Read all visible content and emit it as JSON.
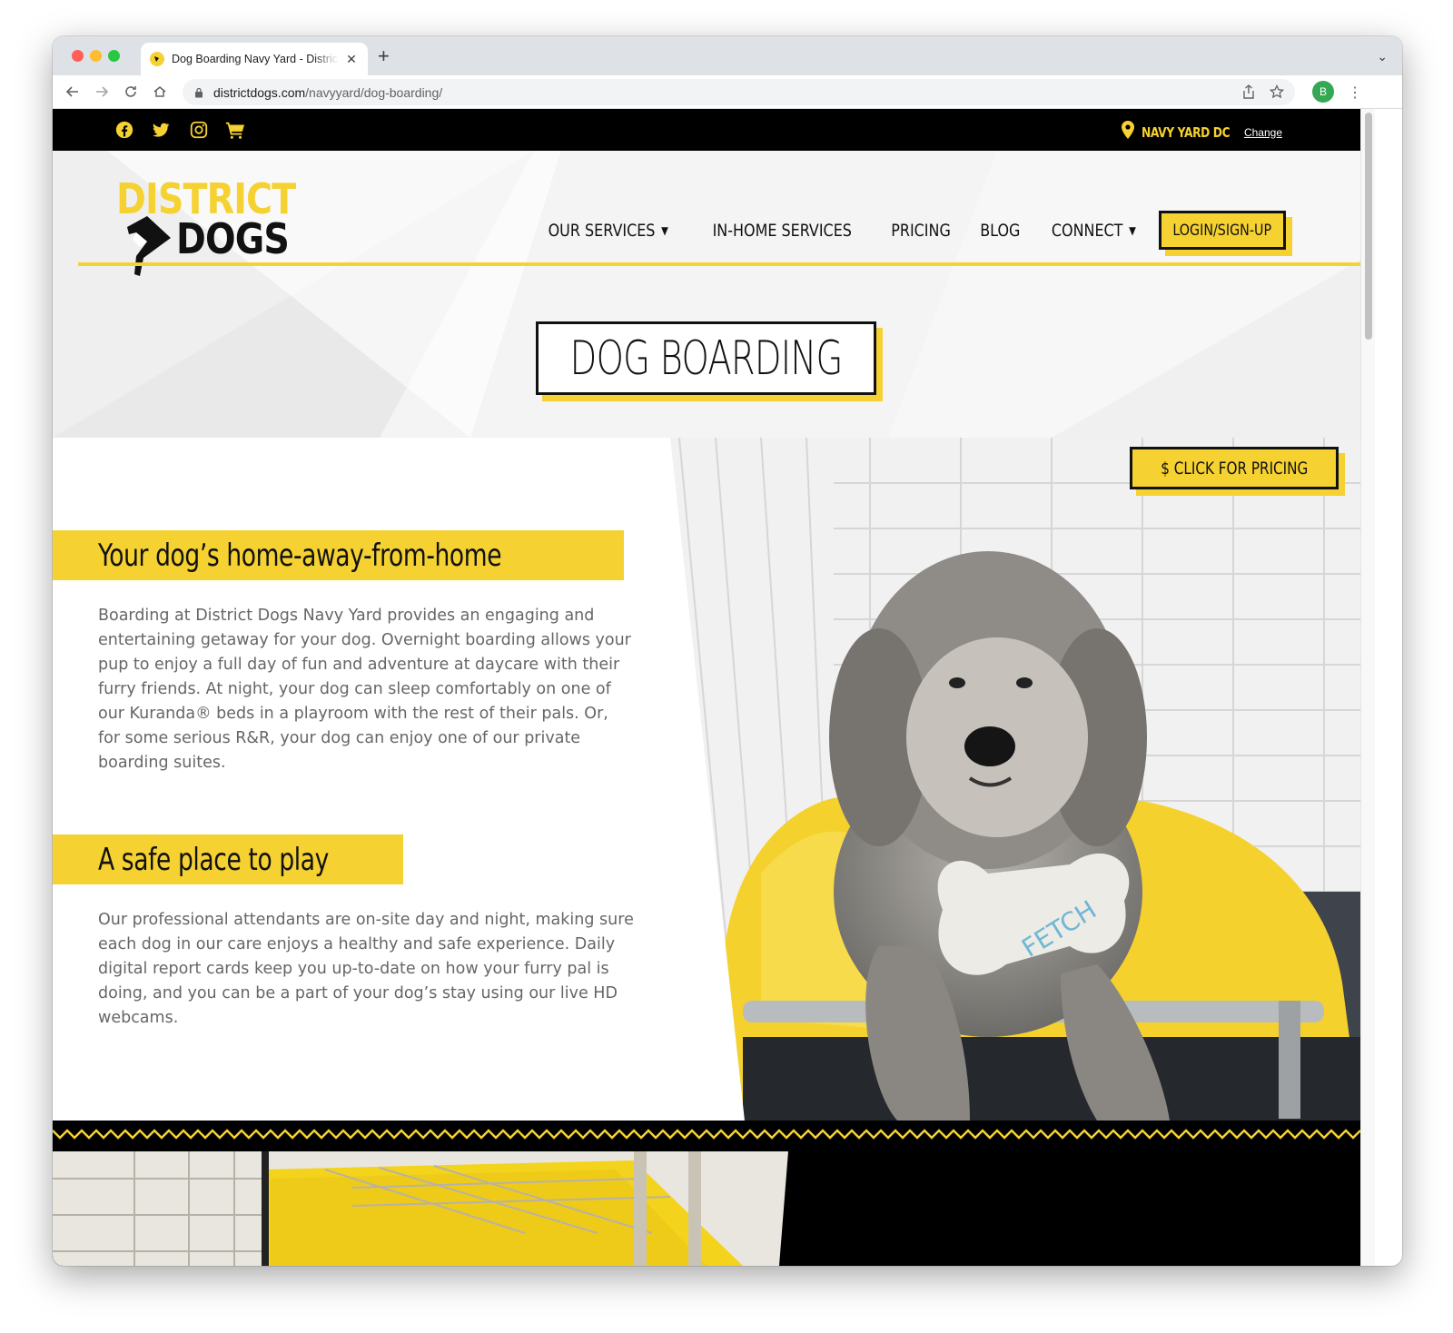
{
  "browser": {
    "tab_title": "Dog Boarding Navy Yard - District Dogs",
    "url_host": "districtdogs.com",
    "url_path": "/navyyard/dog-boarding/",
    "profile_initial": "B"
  },
  "topbar": {
    "social_icons": [
      "facebook-icon",
      "twitter-icon",
      "instagram-icon",
      "cart-icon"
    ],
    "location_label": "NAVY YARD DC",
    "change_label": "Change"
  },
  "logo": {
    "line1": "DISTRICT",
    "line2": "DOGS"
  },
  "nav": {
    "services": "OUR SERVICES",
    "in_home": "IN-HOME SERVICES",
    "pricing": "PRICING",
    "blog": "BLOG",
    "connect": "CONNECT",
    "login": "LOGIN/SIGN-UP"
  },
  "page_title": "DOG BOARDING",
  "pricing_button": "CLICK FOR PRICING",
  "sections": [
    {
      "heading": "Your dog’s home-away-from-home",
      "body": "Boarding at District Dogs Navy Yard provides an engaging and entertaining getaway for your dog. Overnight boarding allows your pup to enjoy a full day of fun and adventure at daycare with their furry friends. At night, your dog can sleep comfortably on one of our Kuranda® beds in a playroom with the rest of their pals. Or, for some serious R&R, your dog can enjoy one of our private boarding suites."
    },
    {
      "heading": "A safe place to play",
      "body": "Our professional attendants are on-site day and night, making sure each dog in our care enjoys a healthy and safe experience. Daily digital report cards keep you up-to-date on how your furry pal is doing, and you can be a part of your dog’s stay using our live HD webcams."
    }
  ],
  "photo_toy_text": "FETCH",
  "colors": {
    "brand_yellow": "#f5d132",
    "black": "#111111",
    "body_gray": "#666666"
  }
}
